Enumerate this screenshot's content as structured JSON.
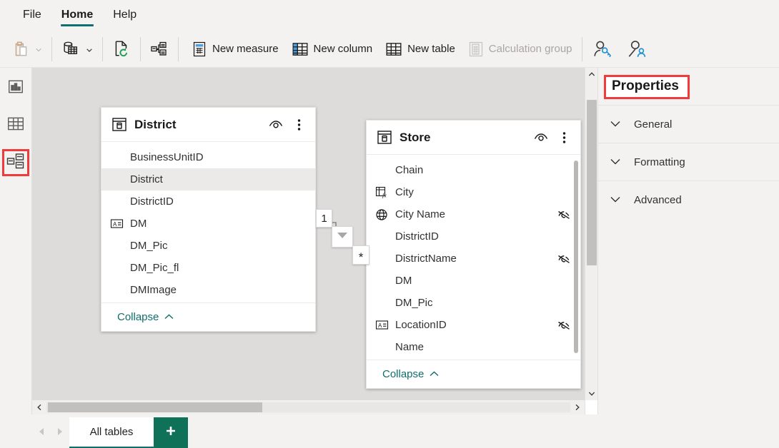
{
  "ribbon": {
    "tabs": [
      {
        "label": "File",
        "active": false
      },
      {
        "label": "Home",
        "active": true
      },
      {
        "label": "Help",
        "active": false
      }
    ],
    "toolbar": {
      "paste_label": "Paste",
      "paste_icon": "clipboard-paste-icon",
      "paste_caret_icon": "chevron-down-icon",
      "get_data_icon": "get-data-database-icon",
      "get_data_caret_icon": "chevron-down-icon",
      "refresh_icon": "refresh-icon",
      "manage_relationships_icon": "manage-relationships-icon",
      "new_measure_label": "New measure",
      "new_measure_icon": "calculator-icon",
      "new_column_label": "New column",
      "new_column_icon": "new-column-table-icon",
      "new_table_label": "New table",
      "new_table_icon": "table-icon",
      "calculation_group_label": "Calculation group",
      "calculation_group_icon": "calculation-group-icon",
      "calculation_group_disabled": true,
      "manage_roles_icon": "manage-roles-key-person-icon",
      "view_as_icon": "view-as-person-icon"
    }
  },
  "view_rail": {
    "items": [
      {
        "name": "report-view",
        "icon": "bar-chart-icon",
        "selected": false
      },
      {
        "name": "data-view",
        "icon": "table-grid-icon",
        "selected": false
      },
      {
        "name": "model-view",
        "icon": "model-diagram-icon",
        "selected": true
      }
    ]
  },
  "canvas": {
    "background_color": "#dddcdb",
    "tables": [
      {
        "name": "District",
        "icon": "table-card-icon",
        "eye_icon": "eye-icon",
        "more_icon": "more-vertical-icon",
        "collapse_label": "Collapse",
        "collapse_icon": "chevron-up-icon",
        "has_scrollbar": false,
        "fields": [
          {
            "label": "BusinessUnitID",
            "icon": null,
            "hidden": false,
            "selected": false
          },
          {
            "label": "District",
            "icon": null,
            "hidden": false,
            "selected": true
          },
          {
            "label": "DistrictID",
            "icon": null,
            "hidden": false,
            "selected": false
          },
          {
            "label": "DM",
            "icon": "sort-by-column-icon",
            "hidden": false,
            "selected": false
          },
          {
            "label": "DM_Pic",
            "icon": null,
            "hidden": false,
            "selected": false
          },
          {
            "label": "DM_Pic_fl",
            "icon": null,
            "hidden": false,
            "selected": false
          },
          {
            "label": "DMImage",
            "icon": null,
            "hidden": false,
            "selected": false
          }
        ]
      },
      {
        "name": "Store",
        "icon": "table-card-icon",
        "eye_icon": "eye-icon",
        "more_icon": "more-vertical-icon",
        "collapse_label": "Collapse",
        "collapse_icon": "chevron-up-icon",
        "has_scrollbar": true,
        "fields": [
          {
            "label": "Chain",
            "icon": null,
            "hidden": false,
            "selected": false
          },
          {
            "label": "City",
            "icon": "calculated-column-fx-icon",
            "hidden": false,
            "selected": false
          },
          {
            "label": "City Name",
            "icon": "globe-icon",
            "hidden": true,
            "selected": false
          },
          {
            "label": "DistrictID",
            "icon": null,
            "hidden": false,
            "selected": false
          },
          {
            "label": "DistrictName",
            "icon": null,
            "hidden": true,
            "selected": false
          },
          {
            "label": "DM",
            "icon": null,
            "hidden": false,
            "selected": false
          },
          {
            "label": "DM_Pic",
            "icon": null,
            "hidden": false,
            "selected": false
          },
          {
            "label": "LocationID",
            "icon": "sort-by-column-icon",
            "hidden": true,
            "selected": false
          },
          {
            "label": "Name",
            "icon": null,
            "hidden": false,
            "selected": false
          }
        ]
      }
    ],
    "relationship": {
      "from_cardinality": "1",
      "to_cardinality": "*",
      "filter_direction_icon": "arrow-down-filter-icon"
    },
    "vertical_scrollbar": {
      "up_icon": "chevron-up-icon",
      "down_icon": "chevron-down-icon"
    },
    "horizontal_scrollbar": {
      "left_icon": "chevron-left-icon",
      "right_icon": "chevron-right-icon"
    }
  },
  "properties": {
    "title": "Properties",
    "highlight_color": "#ef3b3b",
    "sections": [
      {
        "label": "General",
        "icon": "chevron-down-icon",
        "expanded": false
      },
      {
        "label": "Formatting",
        "icon": "chevron-down-icon",
        "expanded": false
      },
      {
        "label": "Advanced",
        "icon": "chevron-down-icon",
        "expanded": false
      }
    ]
  },
  "page_tabs": {
    "prev_icon": "triangle-left-icon",
    "next_icon": "triangle-right-icon",
    "tabs": [
      {
        "label": "All tables",
        "active": true
      }
    ],
    "add_label": "+",
    "add_icon": "plus-icon"
  }
}
